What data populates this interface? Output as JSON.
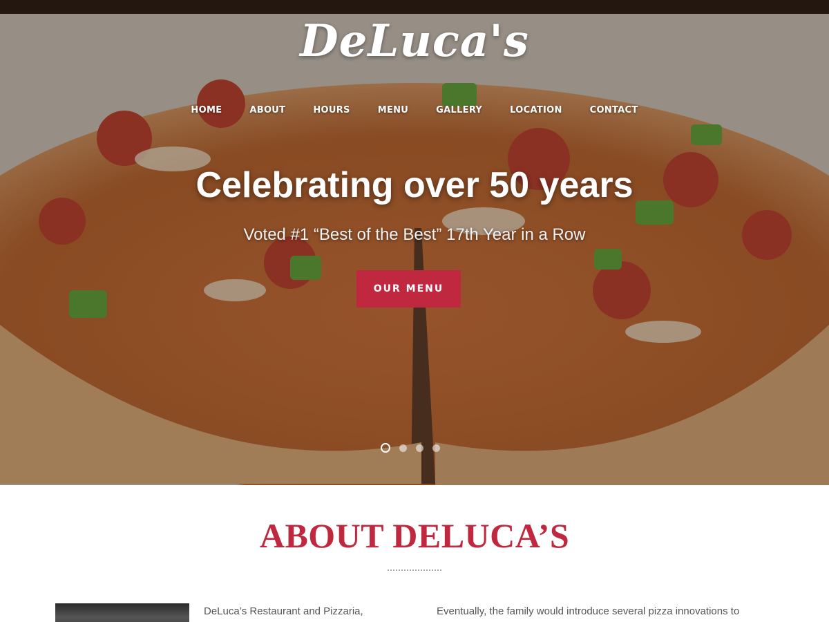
{
  "brand": {
    "logo_text": "DeLuca's"
  },
  "nav": {
    "items": [
      {
        "label": "HOME"
      },
      {
        "label": "ABOUT"
      },
      {
        "label": "HOURS"
      },
      {
        "label": "MENU"
      },
      {
        "label": "GALLERY"
      },
      {
        "label": "LOCATION"
      },
      {
        "label": "CONTACT"
      }
    ]
  },
  "hero": {
    "headline": "Celebrating over 50 years",
    "subheadline": "Voted #1 “Best of the Best” 17th Year in a Row",
    "cta_label": "OUR MENU",
    "slides": {
      "count": 4,
      "active_index": 0
    },
    "image_icon": "pizza-photo"
  },
  "about": {
    "title": "ABOUT DELUCA’S",
    "col1_text": "DeLuca’s Restaurant and Pizzaria,",
    "col2_text": "Eventually, the family would introduce several pizza innovations to"
  },
  "colors": {
    "accent": "#c0283f",
    "text_body": "#555555",
    "nav_text": "#ffffff"
  }
}
